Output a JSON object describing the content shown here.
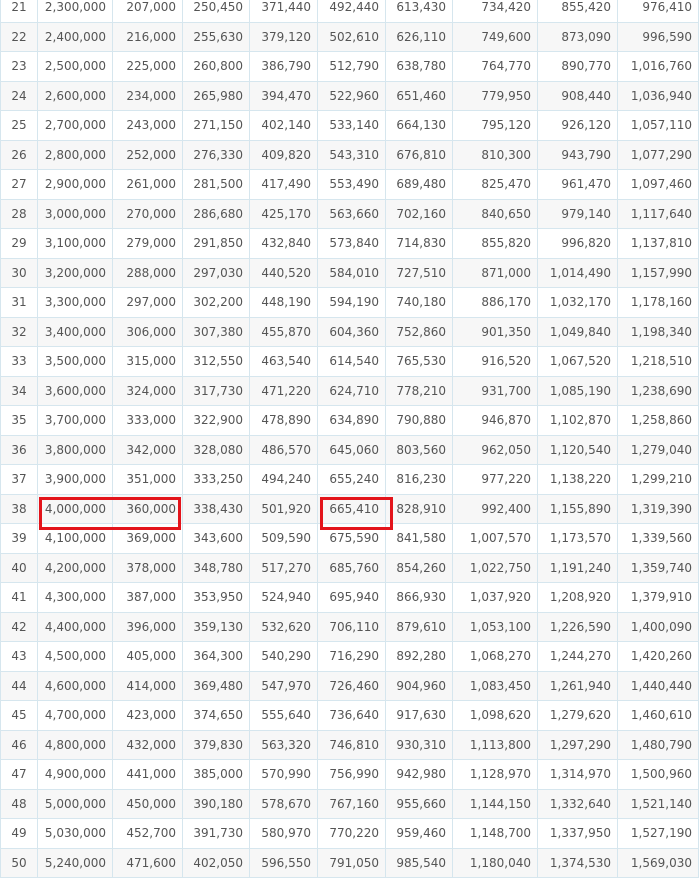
{
  "rows": [
    {
      "no": "21",
      "cells": [
        "2,300,000",
        "207,000",
        "250,450",
        "371,440",
        "492,440",
        "613,430",
        "734,420",
        "855,420",
        "976,410"
      ]
    },
    {
      "no": "22",
      "cells": [
        "2,400,000",
        "216,000",
        "255,630",
        "379,120",
        "502,610",
        "626,110",
        "749,600",
        "873,090",
        "996,590"
      ]
    },
    {
      "no": "23",
      "cells": [
        "2,500,000",
        "225,000",
        "260,800",
        "386,790",
        "512,790",
        "638,780",
        "764,770",
        "890,770",
        "1,016,760"
      ]
    },
    {
      "no": "24",
      "cells": [
        "2,600,000",
        "234,000",
        "265,980",
        "394,470",
        "522,960",
        "651,460",
        "779,950",
        "908,440",
        "1,036,940"
      ]
    },
    {
      "no": "25",
      "cells": [
        "2,700,000",
        "243,000",
        "271,150",
        "402,140",
        "533,140",
        "664,130",
        "795,120",
        "926,120",
        "1,057,110"
      ]
    },
    {
      "no": "26",
      "cells": [
        "2,800,000",
        "252,000",
        "276,330",
        "409,820",
        "543,310",
        "676,810",
        "810,300",
        "943,790",
        "1,077,290"
      ]
    },
    {
      "no": "27",
      "cells": [
        "2,900,000",
        "261,000",
        "281,500",
        "417,490",
        "553,490",
        "689,480",
        "825,470",
        "961,470",
        "1,097,460"
      ]
    },
    {
      "no": "28",
      "cells": [
        "3,000,000",
        "270,000",
        "286,680",
        "425,170",
        "563,660",
        "702,160",
        "840,650",
        "979,140",
        "1,117,640"
      ]
    },
    {
      "no": "29",
      "cells": [
        "3,100,000",
        "279,000",
        "291,850",
        "432,840",
        "573,840",
        "714,830",
        "855,820",
        "996,820",
        "1,137,810"
      ]
    },
    {
      "no": "30",
      "cells": [
        "3,200,000",
        "288,000",
        "297,030",
        "440,520",
        "584,010",
        "727,510",
        "871,000",
        "1,014,490",
        "1,157,990"
      ]
    },
    {
      "no": "31",
      "cells": [
        "3,300,000",
        "297,000",
        "302,200",
        "448,190",
        "594,190",
        "740,180",
        "886,170",
        "1,032,170",
        "1,178,160"
      ]
    },
    {
      "no": "32",
      "cells": [
        "3,400,000",
        "306,000",
        "307,380",
        "455,870",
        "604,360",
        "752,860",
        "901,350",
        "1,049,840",
        "1,198,340"
      ]
    },
    {
      "no": "33",
      "cells": [
        "3,500,000",
        "315,000",
        "312,550",
        "463,540",
        "614,540",
        "765,530",
        "916,520",
        "1,067,520",
        "1,218,510"
      ]
    },
    {
      "no": "34",
      "cells": [
        "3,600,000",
        "324,000",
        "317,730",
        "471,220",
        "624,710",
        "778,210",
        "931,700",
        "1,085,190",
        "1,238,690"
      ]
    },
    {
      "no": "35",
      "cells": [
        "3,700,000",
        "333,000",
        "322,900",
        "478,890",
        "634,890",
        "790,880",
        "946,870",
        "1,102,870",
        "1,258,860"
      ]
    },
    {
      "no": "36",
      "cells": [
        "3,800,000",
        "342,000",
        "328,080",
        "486,570",
        "645,060",
        "803,560",
        "962,050",
        "1,120,540",
        "1,279,040"
      ]
    },
    {
      "no": "37",
      "cells": [
        "3,900,000",
        "351,000",
        "333,250",
        "494,240",
        "655,240",
        "816,230",
        "977,220",
        "1,138,220",
        "1,299,210"
      ]
    },
    {
      "no": "38",
      "cells": [
        "4,000,000",
        "360,000",
        "338,430",
        "501,920",
        "665,410",
        "828,910",
        "992,400",
        "1,155,890",
        "1,319,390"
      ]
    },
    {
      "no": "39",
      "cells": [
        "4,100,000",
        "369,000",
        "343,600",
        "509,590",
        "675,590",
        "841,580",
        "1,007,570",
        "1,173,570",
        "1,339,560"
      ]
    },
    {
      "no": "40",
      "cells": [
        "4,200,000",
        "378,000",
        "348,780",
        "517,270",
        "685,760",
        "854,260",
        "1,022,750",
        "1,191,240",
        "1,359,740"
      ]
    },
    {
      "no": "41",
      "cells": [
        "4,300,000",
        "387,000",
        "353,950",
        "524,940",
        "695,940",
        "866,930",
        "1,037,920",
        "1,208,920",
        "1,379,910"
      ]
    },
    {
      "no": "42",
      "cells": [
        "4,400,000",
        "396,000",
        "359,130",
        "532,620",
        "706,110",
        "879,610",
        "1,053,100",
        "1,226,590",
        "1,400,090"
      ]
    },
    {
      "no": "43",
      "cells": [
        "4,500,000",
        "405,000",
        "364,300",
        "540,290",
        "716,290",
        "892,280",
        "1,068,270",
        "1,244,270",
        "1,420,260"
      ]
    },
    {
      "no": "44",
      "cells": [
        "4,600,000",
        "414,000",
        "369,480",
        "547,970",
        "726,460",
        "904,960",
        "1,083,450",
        "1,261,940",
        "1,440,440"
      ]
    },
    {
      "no": "45",
      "cells": [
        "4,700,000",
        "423,000",
        "374,650",
        "555,640",
        "736,640",
        "917,630",
        "1,098,620",
        "1,279,620",
        "1,460,610"
      ]
    },
    {
      "no": "46",
      "cells": [
        "4,800,000",
        "432,000",
        "379,830",
        "563,320",
        "746,810",
        "930,310",
        "1,113,800",
        "1,297,290",
        "1,480,790"
      ]
    },
    {
      "no": "47",
      "cells": [
        "4,900,000",
        "441,000",
        "385,000",
        "570,990",
        "756,990",
        "942,980",
        "1,128,970",
        "1,314,970",
        "1,500,960"
      ]
    },
    {
      "no": "48",
      "cells": [
        "5,000,000",
        "450,000",
        "390,180",
        "578,670",
        "767,160",
        "955,660",
        "1,144,150",
        "1,332,640",
        "1,521,140"
      ]
    },
    {
      "no": "49",
      "cells": [
        "5,030,000",
        "452,700",
        "391,730",
        "580,970",
        "770,220",
        "959,460",
        "1,148,700",
        "1,337,950",
        "1,527,190"
      ]
    },
    {
      "no": "50",
      "cells": [
        "5,240,000",
        "471,600",
        "402,050",
        "596,550",
        "791,050",
        "985,540",
        "1,180,040",
        "1,374,530",
        "1,569,030"
      ]
    }
  ],
  "highlight_color": "#e3141b",
  "highlights": [
    {
      "row": "38",
      "columns": [
        1,
        2
      ]
    },
    {
      "row": "38",
      "columns": [
        5
      ]
    }
  ]
}
